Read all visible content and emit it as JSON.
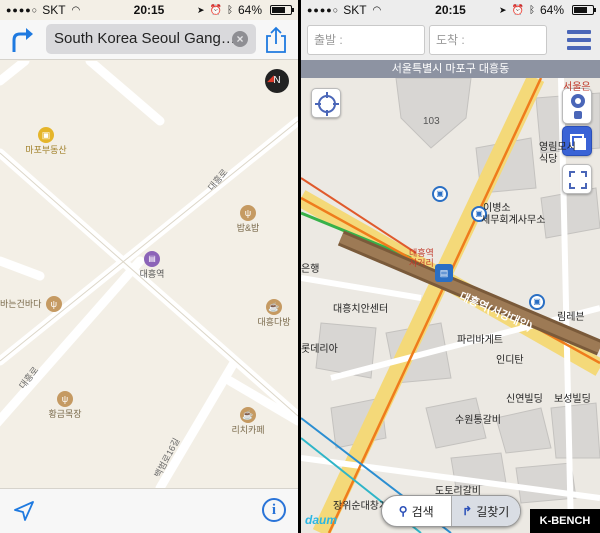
{
  "left": {
    "status": {
      "carrier": "SKT",
      "time": "20:15",
      "battery": "64%",
      "battery_level": 0.64
    },
    "search": {
      "value": "South Korea Seoul Gang…",
      "clear_glyph": "×"
    },
    "compass": {
      "letter": "N"
    },
    "map": {
      "pois": [
        {
          "name": "마포부동산",
          "icon": "shopping-bag-icon"
        },
        {
          "name": "밥&밥",
          "icon": "restaurant-icon"
        },
        {
          "name": "대흥역",
          "icon": "subway-icon"
        },
        {
          "name": "대흥다방",
          "icon": "cafe-icon"
        },
        {
          "name": "바는건바다",
          "icon": "restaurant-icon"
        },
        {
          "name": "황금목장",
          "icon": "restaurant-icon"
        },
        {
          "name": "리치카페",
          "icon": "cafe-icon"
        }
      ],
      "roads": [
        "대흥로",
        "대흥로",
        "백범로16길"
      ]
    },
    "footer": {
      "info_glyph": "i"
    }
  },
  "right": {
    "status": {
      "carrier": "SKT",
      "time": "20:15",
      "battery": "64%",
      "battery_level": 0.64
    },
    "start_placeholder": "출발 :",
    "dest_placeholder": "도착 :",
    "area_name": "서울특별시 마포구 대흥동",
    "map_labels": {
      "building_no": "103",
      "station_name": "대흥역(서강대입)",
      "station_exit": "대흥역",
      "station_exit_sub": "사거리",
      "bank": "은행",
      "safety_center": "대흥치안센터",
      "lotteria": "롯데리아",
      "paris": "파리바게트",
      "inditan": "인디탄",
      "sinyeon": "신연빌딩",
      "boseong": "보성빌딩",
      "suwon": "수원통갈비",
      "doto": "도토리갈비",
      "jangwi": "장위순대창계",
      "accounting": "세무회계사무소",
      "hospital": "이병소",
      "yeonglim": "영림모시",
      "sikdang": "식당",
      "seoul_bank_partial": "서울은",
      "partial_bottom_right": "림레븐"
    },
    "bottom": {
      "search_label": "검색",
      "route_label": "길찾기"
    },
    "logo": "daum",
    "watermark": "K-BENCH"
  }
}
